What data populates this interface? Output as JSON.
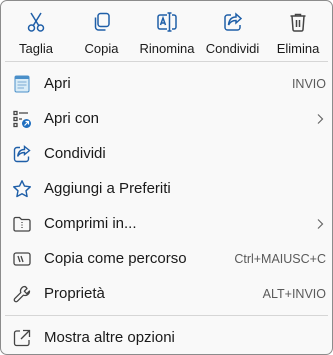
{
  "toolbar": {
    "buttons": [
      {
        "label": "Taglia",
        "icon": "scissors-icon"
      },
      {
        "label": "Copia",
        "icon": "copy-icon"
      },
      {
        "label": "Rinomina",
        "icon": "rename-icon"
      },
      {
        "label": "Condividi",
        "icon": "share-icon"
      },
      {
        "label": "Elimina",
        "icon": "trash-icon"
      }
    ]
  },
  "items": [
    {
      "label": "Apri",
      "shortcut": "INVIO",
      "icon": "notepad-icon"
    },
    {
      "label": "Apri con",
      "icon": "open-with-icon",
      "submenu": true
    },
    {
      "label": "Condividi",
      "icon": "share-icon"
    },
    {
      "label": "Aggiungi a Preferiti",
      "icon": "star-icon"
    },
    {
      "label": "Comprimi in...",
      "icon": "zip-folder-icon",
      "submenu": true
    },
    {
      "label": "Copia come percorso",
      "shortcut": "Ctrl+MAIUSC+C",
      "icon": "copy-path-icon"
    },
    {
      "label": "Proprietà",
      "shortcut": "ALT+INVIO",
      "icon": "wrench-icon"
    },
    {
      "label": "Mostra altre opzioni",
      "icon": "more-options-icon"
    }
  ],
  "colors": {
    "accent": "#1f5fa8",
    "background": "#f9f9f9",
    "border": "#8c8c8c",
    "separator": "#d6d6d6"
  }
}
